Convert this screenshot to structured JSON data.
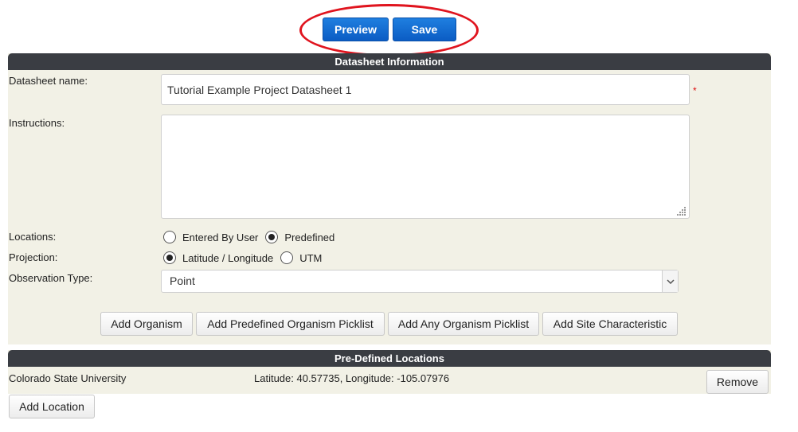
{
  "toolbar": {
    "preview_label": "Preview",
    "save_label": "Save"
  },
  "datasheet_info": {
    "header": "Datasheet Information",
    "name_label": "Datasheet name:",
    "name_value": "Tutorial Example Project Datasheet 1",
    "required_mark": "*",
    "instructions_label": "Instructions:",
    "instructions_value": "",
    "locations_label": "Locations:",
    "locations_options": [
      {
        "label": "Entered By User",
        "selected": false
      },
      {
        "label": "Predefined",
        "selected": true
      }
    ],
    "projection_label": "Projection:",
    "projection_options": [
      {
        "label": "Latitude / Longitude",
        "selected": true
      },
      {
        "label": "UTM",
        "selected": false
      }
    ],
    "observation_type_label": "Observation Type:",
    "observation_type_value": "Point",
    "buttons": {
      "add_organism": "Add Organism",
      "add_predefined_picklist": "Add Predefined Organism Picklist",
      "add_any_picklist": "Add Any Organism Picklist",
      "add_site_characteristic": "Add Site Characteristic"
    }
  },
  "predefined_locations": {
    "header": "Pre-Defined Locations",
    "rows": [
      {
        "name": "Colorado State University",
        "coords": "Latitude: 40.57735, Longitude: -105.07976",
        "remove_label": "Remove"
      }
    ],
    "add_location_label": "Add Location"
  },
  "colors": {
    "header_bg": "#3a3d43",
    "panel_bg": "#f2f1e6",
    "primary_button": "#0b5cc4",
    "highlight": "#e0141e",
    "required": "#dd1111"
  }
}
